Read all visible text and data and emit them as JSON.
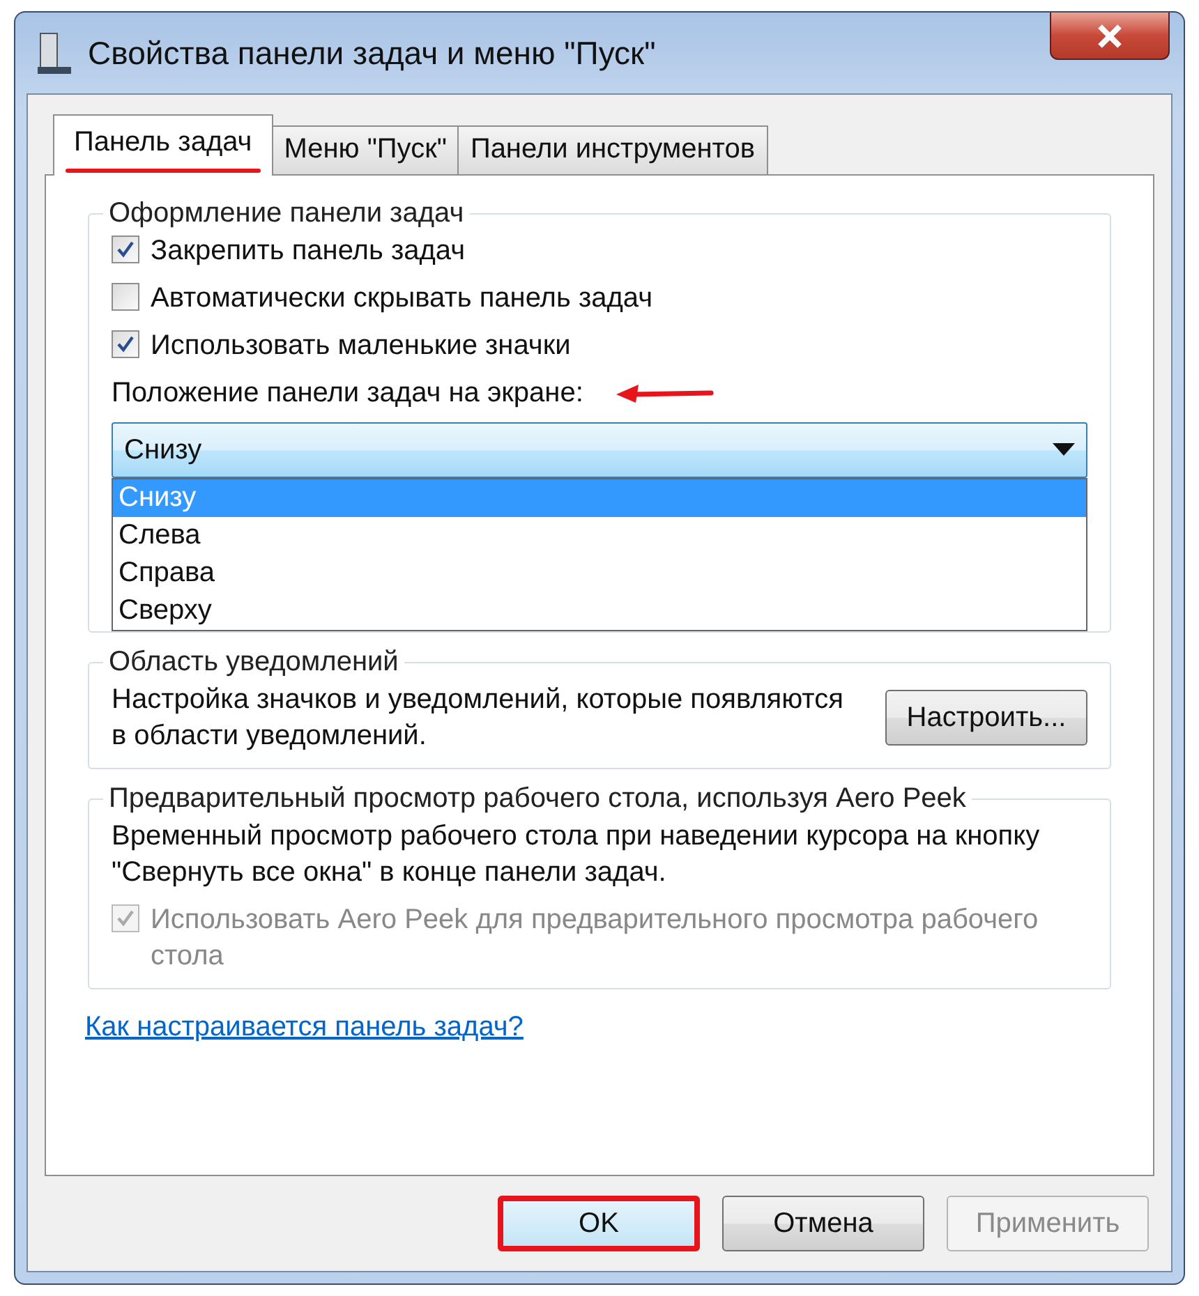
{
  "window": {
    "title": "Свойства панели задач и меню \"Пуск\""
  },
  "tabs": [
    {
      "label": "Панель задач",
      "selected": true,
      "annotated": true
    },
    {
      "label": "Меню \"Пуск\"",
      "selected": false,
      "annotated": false
    },
    {
      "label": "Панели инструментов",
      "selected": false,
      "annotated": false
    }
  ],
  "appearance": {
    "title": "Оформление панели задач",
    "checkboxes": [
      {
        "label": "Закрепить панель задач",
        "checked": true
      },
      {
        "label": "Автоматически скрывать панель задач",
        "checked": false
      },
      {
        "label": "Использовать маленькие значки",
        "checked": true
      }
    ],
    "position_label": "Положение панели задач на экране:",
    "position_annotated": true,
    "position": {
      "value": "Снизу",
      "expanded": true,
      "options": [
        {
          "label": "Снизу",
          "selected": true
        },
        {
          "label": "Слева",
          "selected": false
        },
        {
          "label": "Справа",
          "selected": false
        },
        {
          "label": "Сверху",
          "selected": false
        }
      ]
    }
  },
  "notifications": {
    "title": "Область уведомлений",
    "text": "Настройка значков и уведомлений, которые появляются в области уведомлений.",
    "button": "Настроить..."
  },
  "peek": {
    "title": "Предварительный просмотр рабочего стола, используя Aero Peek",
    "text": "Временный просмотр рабочего стола при наведении курсора на кнопку \"Свернуть все окна\" в конце панели задач.",
    "checkbox": {
      "label": "Использовать Aero Peek для предварительного просмотра рабочего стола",
      "checked": true,
      "disabled": true
    }
  },
  "help_link": "Как настраивается панель задач?",
  "buttons": [
    {
      "label": "OK",
      "disabled": false,
      "annotated": true
    },
    {
      "label": "Отмена",
      "disabled": false,
      "annotated": false
    },
    {
      "label": "Применить",
      "disabled": true,
      "annotated": false
    }
  ]
}
